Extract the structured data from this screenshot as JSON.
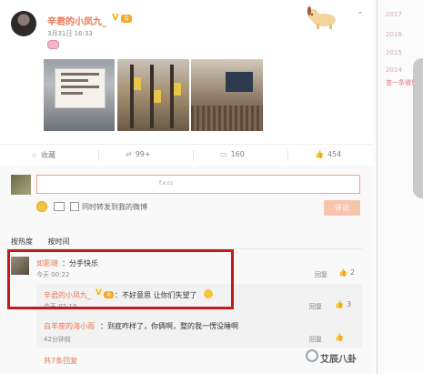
{
  "post": {
    "username": "辛君的小凤九_",
    "verified_badge": "V",
    "vip_badge": "会",
    "date": "3月31日 16:33"
  },
  "actions": {
    "favorite_label": "收藏",
    "repost_count": "99+",
    "comment_count": "160",
    "like_count": "454"
  },
  "comment_box": {
    "input_hint": "f.x.cc",
    "repost_checkbox_label": "同时转发到我的微博",
    "submit_label": "评论"
  },
  "sort_tabs": [
    "按热度",
    "按时间"
  ],
  "comments": [
    {
      "name": "如影随",
      "text": "：分手快乐",
      "time": "今天 00:22",
      "reply_label": "回复",
      "likes": "2",
      "replies": [
        {
          "name": "辛君的小凤九_",
          "text": "：不好意思 让你们失望了",
          "time": "今天 02:10",
          "reply_label": "回复",
          "likes": "3"
        },
        {
          "name": "白羊座的海小雨",
          "text": "：到底咋样了，你俩啊，整的我一愣没睡啊",
          "time": "42分钟前",
          "reply_label": "回复",
          "likes": ""
        }
      ],
      "more_label": "共7条回复"
    }
  ],
  "timeline_years": [
    "2017",
    "2016",
    "2015",
    "2014"
  ],
  "timeline_more": "查一条微博",
  "watermark": "艾辰八卦",
  "colors": {
    "accent": "#eb7350",
    "highlight_box": "#c41a1a",
    "input_border": "#f4a27f"
  }
}
